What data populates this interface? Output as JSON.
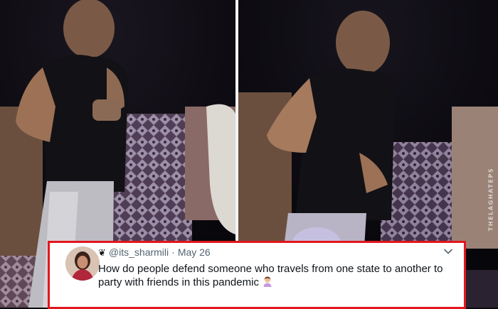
{
  "image": {
    "watermark_text": "THELAGHATEPS",
    "divider_color": "#f4f4f4"
  },
  "tweet": {
    "verified_mark": "❦",
    "handle": "@its_sharmili",
    "separator": "·",
    "date": "May 26",
    "text": "How do people defend someone who travels from one state to another to party with friends in this pandemic",
    "emoji_name": "person-facepalming-emoji",
    "menu_icon": "chevron-down-icon",
    "border_color": "#e3161d"
  }
}
